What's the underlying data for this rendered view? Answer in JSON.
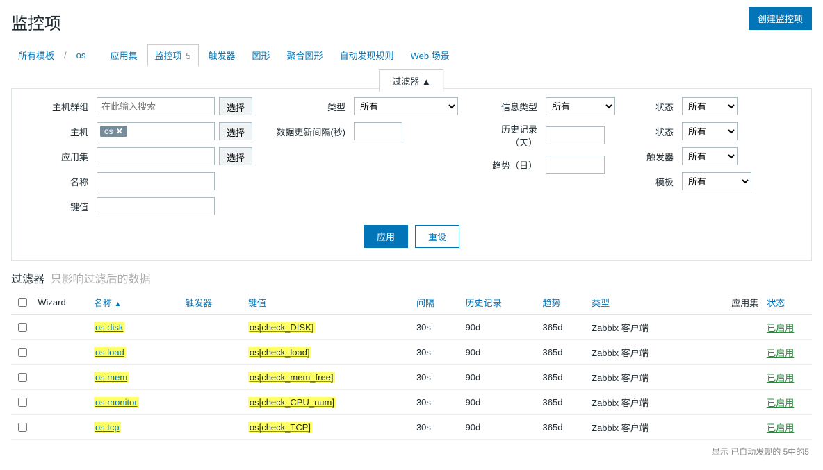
{
  "header": {
    "title": "监控项",
    "create_button": "创建监控项"
  },
  "breadcrumbs": {
    "all_templates": "所有模板",
    "template_name": "os"
  },
  "tabs": {
    "applications": "应用集",
    "items": "监控项",
    "items_count": "5",
    "triggers": "触发器",
    "graphs": "图形",
    "screens": "聚合图形",
    "discovery": "自动发现规则",
    "web": "Web 场景"
  },
  "filter": {
    "toggle_label": "过滤器 ▲",
    "labels": {
      "hostgroup": "主机群组",
      "host": "主机",
      "application": "应用集",
      "name": "名称",
      "key": "键值",
      "type": "类型",
      "update_interval": "数据更新间隔(秒)",
      "info_type": "信息类型",
      "history": "历史记录（天）",
      "trends": "趋势（日）",
      "state": "状态",
      "status": "状态",
      "triggers_opt": "触发器",
      "template_opt": "模板"
    },
    "placeholder_search": "在此输入搜索",
    "host_tag": "os",
    "select_btn": "选择",
    "option_all": "所有",
    "apply": "应用",
    "reset": "重设"
  },
  "subheader": {
    "title": "过滤器",
    "note": "只影响过滤后的数据"
  },
  "table": {
    "columns": {
      "wizard": "Wizard",
      "name": "名称",
      "triggers": "触发器",
      "key": "键值",
      "interval": "间隔",
      "history": "历史记录",
      "trends": "趋势",
      "type": "类型",
      "applications": "应用集",
      "status": "状态"
    },
    "sort_arrow": "▲",
    "rows": [
      {
        "name": "os.disk",
        "key": "os[check_DISK]",
        "interval": "30s",
        "history": "90d",
        "trends": "365d",
        "type": "Zabbix 客户端",
        "status": "已启用"
      },
      {
        "name": "os.load",
        "key": "os[check_load]",
        "interval": "30s",
        "history": "90d",
        "trends": "365d",
        "type": "Zabbix 客户端",
        "status": "已启用"
      },
      {
        "name": "os.mem",
        "key": "os[check_mem_free]",
        "interval": "30s",
        "history": "90d",
        "trends": "365d",
        "type": "Zabbix 客户端",
        "status": "已启用"
      },
      {
        "name": "os.monitor",
        "key": "os[check_CPU_num]",
        "interval": "30s",
        "history": "90d",
        "trends": "365d",
        "type": "Zabbix 客户端",
        "status": "已启用"
      },
      {
        "name": "os.tcp",
        "key": "os[check_TCP]",
        "interval": "30s",
        "history": "90d",
        "trends": "365d",
        "type": "Zabbix 客户端",
        "status": "已启用"
      }
    ]
  },
  "footer": "显示 已自动发现的 5中的5"
}
